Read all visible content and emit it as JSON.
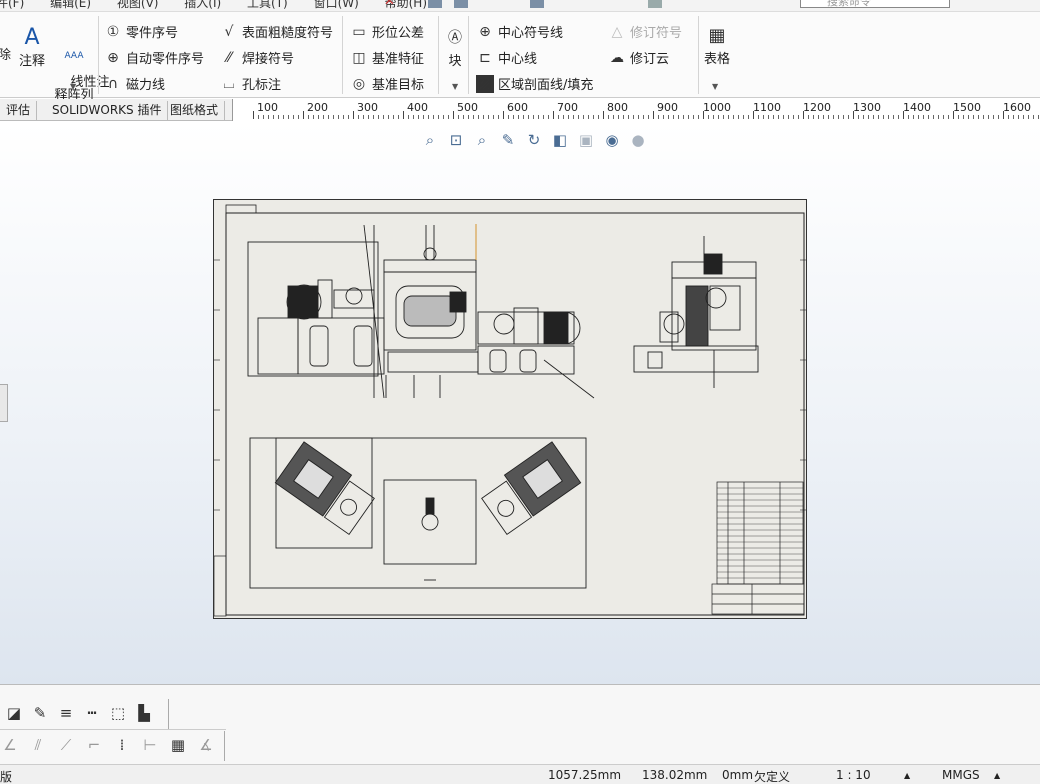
{
  "menubar": {
    "items": [
      "件(F)",
      "编辑(E)",
      "视图(V)",
      "插入(I)",
      "工具(T)",
      "窗口(W)",
      "帮助(H)"
    ],
    "close": "✕",
    "search_placeholder": "搜索命令"
  },
  "ribbon": {
    "delete_partial": "除",
    "annotation": "注释",
    "linear_pattern": "线性注\n释阵列",
    "balloon": "零件序号",
    "auto_balloon": "自动零件序号",
    "magnetic_line": "磁力线",
    "surface_finish": "表面粗糙度符号",
    "weld_symbol": "焊接符号",
    "hole_callout": "孔标注",
    "gtol": "形位公差",
    "datum_feature": "基准特征",
    "datum_target": "基准目标",
    "block": "块",
    "centermark": "中心符号线",
    "centerline": "中心线",
    "area_hatch": "区域剖面线/填充",
    "revision_symbol": "修订符号",
    "revision_cloud": "修订云",
    "table": "表格"
  },
  "tabs": [
    "评估",
    "SOLIDWORKS 插件",
    "图纸格式"
  ],
  "ruler": [
    "100",
    "200",
    "300",
    "400",
    "500",
    "600",
    "700",
    "800",
    "900",
    "1000",
    "1100",
    "1200",
    "1300",
    "1400",
    "1500",
    "1600"
  ],
  "hud_icons": [
    "zoom-to-fit-icon",
    "zoom-to-area-icon",
    "previous-view-icon",
    "pan-icon",
    "rotate-icon",
    "view-orientation-icon",
    "display-style-icon",
    "hide-show-icon",
    "appearance-icon"
  ],
  "statusbar": {
    "edition": "版",
    "x": "1057.25mm",
    "y": "138.02mm",
    "z": "0mm",
    "state": "欠定义",
    "scale": "1 : 10",
    "units": "MMGS"
  },
  "colors": {
    "sheet": "#ecebe6",
    "accent": "#1a56a8",
    "line": "#222222"
  }
}
